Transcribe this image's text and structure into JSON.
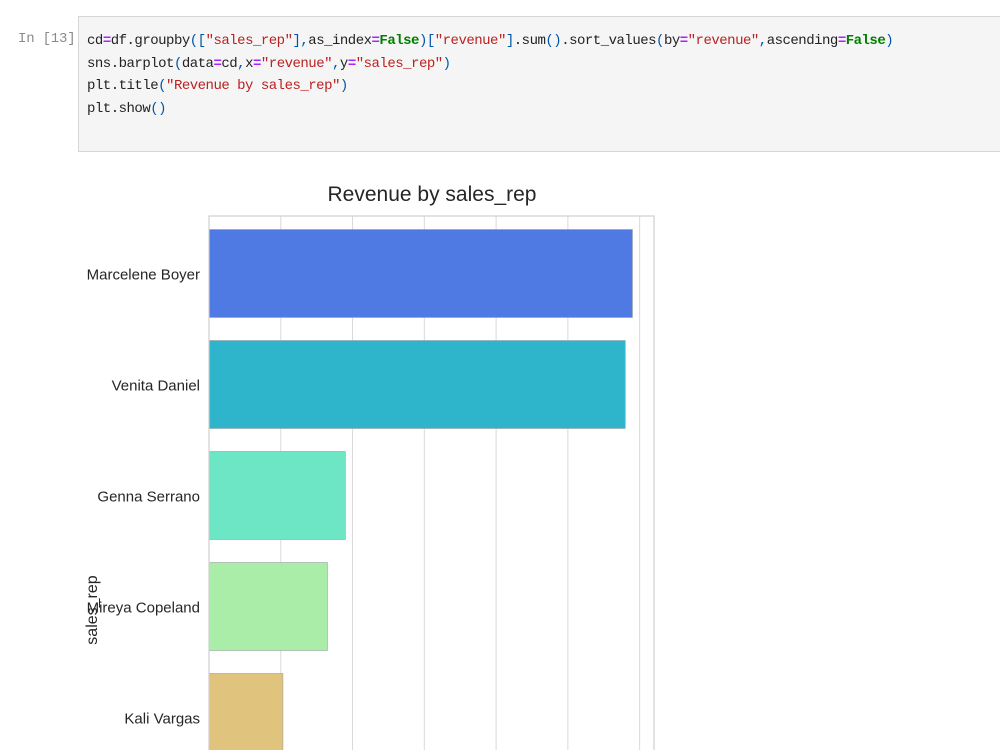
{
  "cell": {
    "prompt": "In [13]:",
    "code_lines": [
      [
        {
          "t": "var",
          "v": "cd"
        },
        {
          "t": "op",
          "v": "="
        },
        {
          "t": "var",
          "v": "df"
        },
        {
          "t": "var",
          "v": ".groupby"
        },
        {
          "t": "punc",
          "v": "(["
        },
        {
          "t": "str",
          "v": "\"sales_rep\""
        },
        {
          "t": "punc",
          "v": "],"
        },
        {
          "t": "var",
          "v": "as_index"
        },
        {
          "t": "op",
          "v": "="
        },
        {
          "t": "kw",
          "v": "False"
        },
        {
          "t": "punc",
          "v": ")["
        },
        {
          "t": "str",
          "v": "\"revenue\""
        },
        {
          "t": "punc",
          "v": "]"
        },
        {
          "t": "var",
          "v": ".sum"
        },
        {
          "t": "punc",
          "v": "()"
        },
        {
          "t": "var",
          "v": ".sort_values"
        },
        {
          "t": "punc",
          "v": "("
        },
        {
          "t": "var",
          "v": "by"
        },
        {
          "t": "op",
          "v": "="
        },
        {
          "t": "str",
          "v": "\"revenue\""
        },
        {
          "t": "punc",
          "v": ","
        },
        {
          "t": "var",
          "v": "ascending"
        },
        {
          "t": "op",
          "v": "="
        },
        {
          "t": "kw",
          "v": "False"
        },
        {
          "t": "punc",
          "v": ")"
        }
      ],
      [
        {
          "t": "var",
          "v": "sns"
        },
        {
          "t": "var",
          "v": ".barplot"
        },
        {
          "t": "punc",
          "v": "("
        },
        {
          "t": "var",
          "v": "data"
        },
        {
          "t": "op",
          "v": "="
        },
        {
          "t": "var",
          "v": "cd"
        },
        {
          "t": "punc",
          "v": ","
        },
        {
          "t": "var",
          "v": "x"
        },
        {
          "t": "op",
          "v": "="
        },
        {
          "t": "str",
          "v": "\"revenue\""
        },
        {
          "t": "punc",
          "v": ","
        },
        {
          "t": "var",
          "v": "y"
        },
        {
          "t": "op",
          "v": "="
        },
        {
          "t": "str",
          "v": "\"sales_rep\""
        },
        {
          "t": "punc",
          "v": ")"
        }
      ],
      [
        {
          "t": "var",
          "v": "plt"
        },
        {
          "t": "var",
          "v": ".title"
        },
        {
          "t": "punc",
          "v": "("
        },
        {
          "t": "str",
          "v": "\"Revenue by sales_rep\""
        },
        {
          "t": "punc",
          "v": ")"
        }
      ],
      [
        {
          "t": "var",
          "v": "plt"
        },
        {
          "t": "var",
          "v": ".show"
        },
        {
          "t": "punc",
          "v": "()"
        }
      ]
    ]
  },
  "colors": {
    "code_bg": "#f5f5f5",
    "keyword": "#008000",
    "string": "#ba2121",
    "operator": "#aa22ff"
  },
  "chart_data": {
    "type": "bar",
    "orientation": "horizontal",
    "title": "Revenue by sales_rep",
    "ylabel": "sales_rep",
    "xlabel": "",
    "categories": [
      "Marcelene Boyer",
      "Venita Daniel",
      "Genna Serrano",
      "Mireya Copeland",
      "Kali Vargas"
    ],
    "values": [
      5.9,
      5.8,
      1.9,
      1.65,
      1.03
    ],
    "colors": [
      "#4f79e3",
      "#2eb5cc",
      "#6de6c6",
      "#aaeda9",
      "#e0c47e"
    ],
    "xlim": [
      0,
      6.2
    ],
    "grid_x": true
  }
}
